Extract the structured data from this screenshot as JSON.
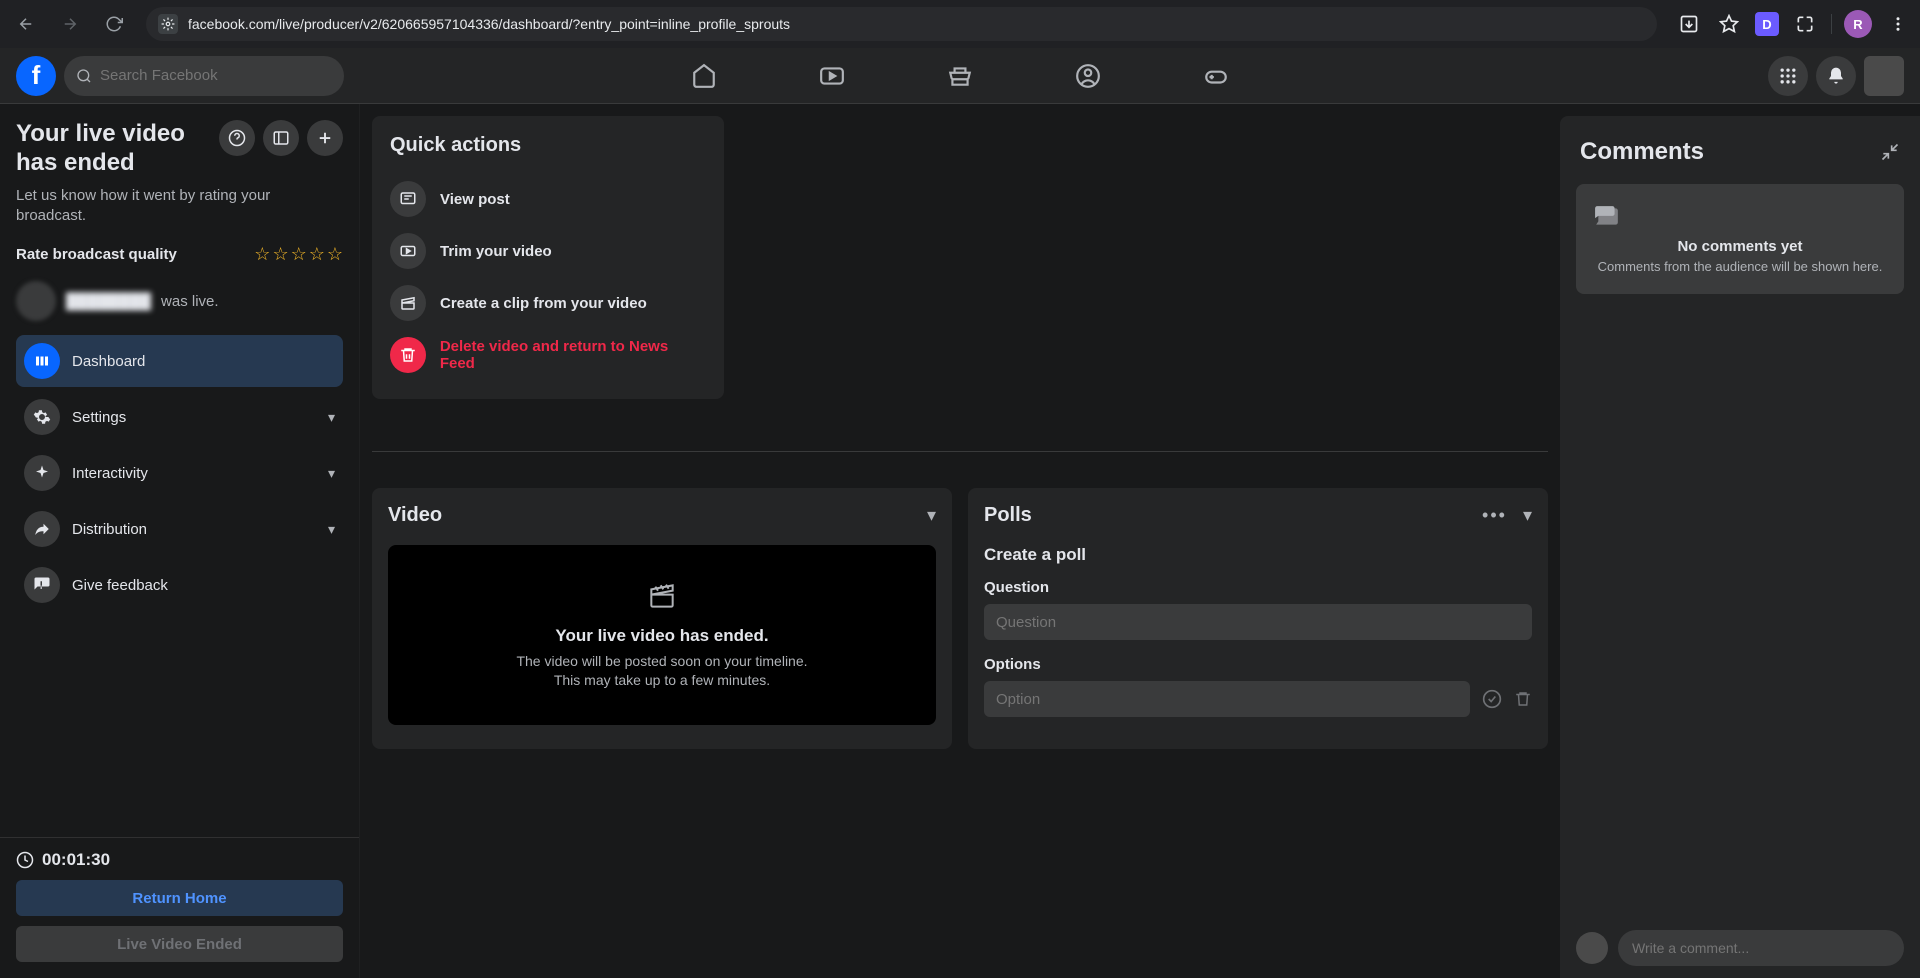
{
  "browser": {
    "url": "facebook.com/live/producer/v2/620665957104336/dashboard/?entry_point=inline_profile_sprouts",
    "avatar_initial": "R",
    "ext_label": "D"
  },
  "header": {
    "logo_letter": "f",
    "search_placeholder": "Search Facebook"
  },
  "sidebar": {
    "title": "Your live video has ended",
    "subtitle": "Let us know how it went by rating your broadcast.",
    "rate_label": "Rate broadcast quality",
    "user_suffix": " was live.",
    "nav": {
      "dashboard": "Dashboard",
      "settings": "Settings",
      "interactivity": "Interactivity",
      "distribution": "Distribution",
      "feedback": "Give feedback"
    },
    "timer": "00:01:30",
    "return_home": "Return Home",
    "ended_btn": "Live Video Ended"
  },
  "quick": {
    "title": "Quick actions",
    "view_post": "View post",
    "trim": "Trim your video",
    "clip": "Create a clip from your video",
    "delete": "Delete video and return to News Feed"
  },
  "video": {
    "title": "Video",
    "ended_title": "Your live video has ended.",
    "ended_sub": "The video will be posted soon on your timeline. This may take up to a few minutes."
  },
  "polls": {
    "title": "Polls",
    "create": "Create a poll",
    "question_label": "Question",
    "question_placeholder": "Question",
    "options_label": "Options",
    "option_placeholder": "Option"
  },
  "comments": {
    "title": "Comments",
    "empty_title": "No comments yet",
    "empty_sub": "Comments from the audience will be shown here.",
    "input_placeholder": "Write a comment..."
  }
}
